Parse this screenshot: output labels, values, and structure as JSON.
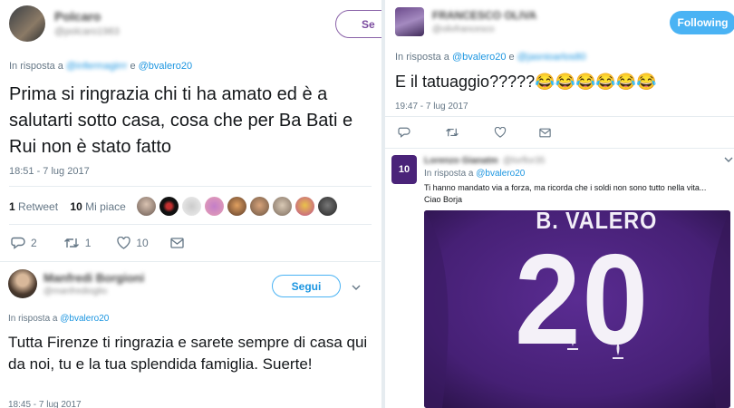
{
  "colors": {
    "accent": "#1b95e0",
    "muted": "#657786",
    "jersey": "#4a2379"
  },
  "left": {
    "tweet1": {
      "display_name": "Polcaro",
      "handle": "@polcaro1983",
      "follow_label": "Se",
      "reply_prefix": "In risposta a",
      "reply_blurred": "@infermagirrr",
      "reply_conj": "e",
      "reply_to": "@bvalero20",
      "text": "Prima si ringrazia chi ti ha amato ed è a salutarti sotto casa, cosa che per Ba Bati e Rui non è stato fatto",
      "timestamp": "18:51 - 7 lug 2017",
      "retweets_count": "1",
      "retweets_label": "Retweet",
      "likes_count": "10",
      "likes_label": "Mi piace",
      "reply_count": "2",
      "retweet_action_count": "1",
      "like_action_count": "10"
    },
    "tweet2": {
      "display_name": "Manfredi Borgioni",
      "handle": "@manfredioglio",
      "follow_label": "Segui",
      "reply_prefix": "In risposta a",
      "reply_to": "@bvalero20",
      "text": "Tutta Firenze ti ringrazia e sarete sempre di casa qui da noi, tu e la tua splendida famiglia. Suerte!",
      "timestamp": "18:45 - 7 lug 2017"
    }
  },
  "right": {
    "tweet1": {
      "display_name": "FRANCESCO OLIVA",
      "handle": "@olivfrancesco",
      "follow_label": "Following",
      "reply_prefix": "In risposta a",
      "reply_to": "@bvalero20",
      "reply_conj": "e",
      "reply_blurred": "@jasnioarlos80",
      "text": "E il tatuaggio?????😂😂😂😂😂😂",
      "timestamp": "19:47 - 7 lug 2017"
    },
    "tweet2": {
      "display_name": "Lorenzo Gianatm",
      "handle": "@lorflor35",
      "reply_prefix": "In risposta a",
      "reply_to": "@bvalero20",
      "text": "Ti hanno mandato via a forza, ma ricorda che i soldi non sono tutto nella vita...",
      "signoff": "Ciao Borja",
      "avatar_number": "10",
      "jersey_name": "B. VALERO",
      "jersey_number": "20"
    }
  }
}
